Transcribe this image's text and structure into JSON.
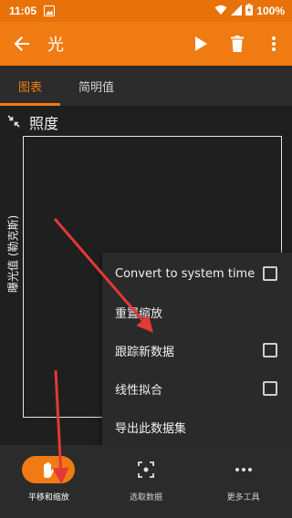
{
  "status_bar": {
    "time": "11:05",
    "battery": "100%"
  },
  "app_bar": {
    "title": "光",
    "accent_color": "#f07b12"
  },
  "tabs": [
    {
      "label": "图表",
      "active": true
    },
    {
      "label": "简明值",
      "active": false
    }
  ],
  "chart": {
    "title": "照度",
    "ylabel": "曝光值 (勒克斯)"
  },
  "menu": {
    "items": [
      {
        "label": "Convert to system time",
        "checkbox": true,
        "checked": false
      },
      {
        "label": "重置缩放",
        "checkbox": false
      },
      {
        "label": "跟踪新数据",
        "checkbox": true,
        "checked": false
      },
      {
        "label": "线性拟合",
        "checkbox": true,
        "checked": false
      },
      {
        "label": "导出此数据集",
        "checkbox": false
      }
    ]
  },
  "bottom_nav": {
    "items": [
      {
        "label": "平移和缩放",
        "icon": "hand-icon",
        "active": true
      },
      {
        "label": "选取数据",
        "icon": "select-icon",
        "active": false
      },
      {
        "label": "更多工具",
        "icon": "more-horiz-icon",
        "active": false
      }
    ]
  },
  "annotation_color": "#e53935"
}
